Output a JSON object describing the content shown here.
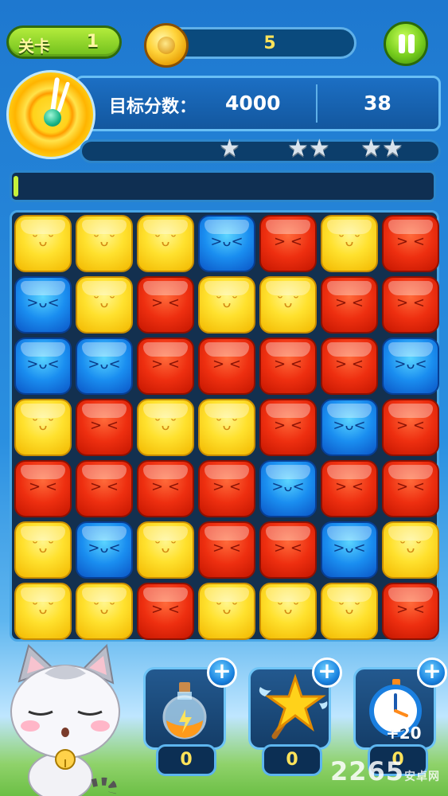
{
  "hud": {
    "level_label": "关卡",
    "level_value": "1",
    "coins": "5",
    "target_label": "目标分数：",
    "target_score": "4000",
    "moves_left": "38"
  },
  "board": {
    "rows": [
      [
        "yellow",
        "yellow",
        "yellow",
        "blue",
        "red",
        "yellow",
        "red"
      ],
      [
        "blue",
        "yellow",
        "red",
        "yellow",
        "yellow",
        "red",
        "red"
      ],
      [
        "blue",
        "blue",
        "red",
        "red",
        "red",
        "red",
        "blue"
      ],
      [
        "yellow",
        "red",
        "yellow",
        "yellow",
        "red",
        "blue",
        "red"
      ],
      [
        "red",
        "red",
        "red",
        "red",
        "blue",
        "red",
        "red"
      ],
      [
        "yellow",
        "blue",
        "yellow",
        "red",
        "red",
        "blue",
        "yellow"
      ],
      [
        "yellow",
        "yellow",
        "red",
        "yellow",
        "yellow",
        "yellow",
        "red"
      ]
    ],
    "faces": {
      "yellow": "˘ᴗ˘",
      "red": "> <",
      "blue": ">ᴗ<"
    }
  },
  "score_progress": 0,
  "time_progress": 0.01,
  "items": [
    {
      "name": "potion",
      "count": "0"
    },
    {
      "name": "star-wand",
      "count": "0"
    },
    {
      "name": "stopwatch",
      "count": "0",
      "badge": "+20"
    }
  ],
  "colors": {
    "yellow": "#ffe12e",
    "red": "#ee2f10",
    "blue": "#1a8ef0"
  },
  "watermark": {
    "text": "2265",
    "small": "安卓网"
  }
}
